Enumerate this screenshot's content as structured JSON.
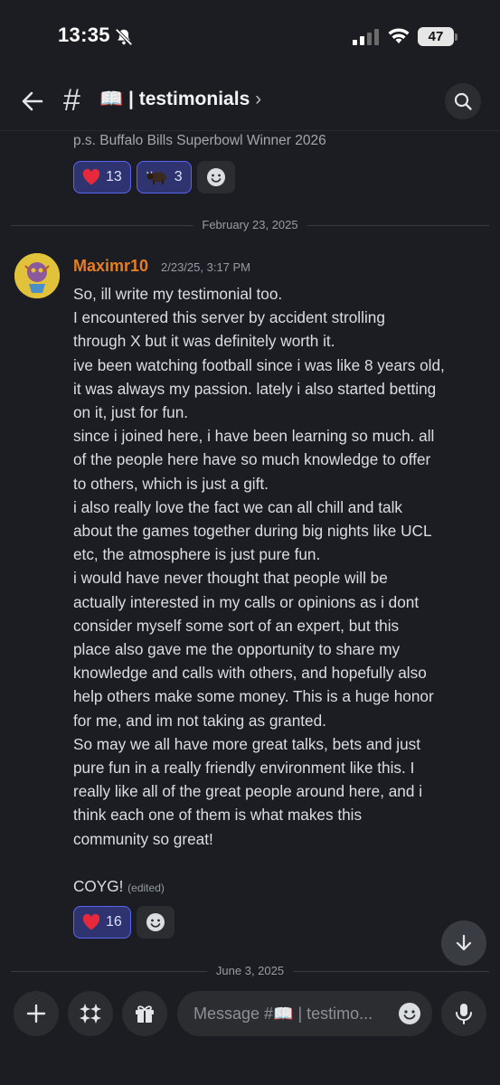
{
  "status_bar": {
    "time": "13:35",
    "battery": "47"
  },
  "header": {
    "channel_emoji": "📖",
    "channel_name": "| testimonials",
    "chevron": "›"
  },
  "previous_message": {
    "tail_text": "p.s. Buffalo Bills Superbowl Winner 2026",
    "reactions": [
      {
        "icon": "heart-emoji",
        "count": "13"
      },
      {
        "icon": "bison-emoji",
        "count": "3"
      }
    ]
  },
  "dividers": {
    "first": "February 23, 2025",
    "second": "June 3, 2025"
  },
  "message": {
    "author": "Maximr10",
    "timestamp": "2/23/25, 3:17 PM",
    "lines": [
      "So, ill write my testimonial too.",
      "I encountered this server by accident strolling",
      "through X but it was definitely worth it.",
      "ive been watching football since i was like 8 years old,",
      "it was always my passion. lately i also started betting",
      "on it, just for fun.",
      "since i joined here, i have been learning so much. all",
      "of the people here have so much knowledge to offer",
      "to others, which is just a gift.",
      "i also really love the fact we can all chill and talk",
      "about the games together during big nights like UCL",
      "etc, the atmosphere is just pure fun.",
      "i would have never thought that people will be",
      "actually interested in my calls or opinions as i dont",
      "consider myself some sort of an expert, but this",
      "place also gave me the opportunity to share my",
      "knowledge and calls with others, and hopefully also",
      "help others make some money. This is a huge honor",
      "for me, and im not taking as granted.",
      "So may we all have more great talks, bets and just",
      "pure fun in a really friendly environment like this. I",
      "really like all of the great people around here, and i",
      "think each one of them is what makes this",
      "community so great!"
    ],
    "closing": "COYG!",
    "edited_label": "(edited)",
    "reactions": [
      {
        "icon": "heart-emoji",
        "count": "16"
      }
    ]
  },
  "input": {
    "placeholder": "Message #📖 | testimo..."
  },
  "colors": {
    "author": "#e67e22",
    "reaction_bg": "#2f3470",
    "reaction_border": "#5865f2",
    "background": "#1c1d22"
  }
}
